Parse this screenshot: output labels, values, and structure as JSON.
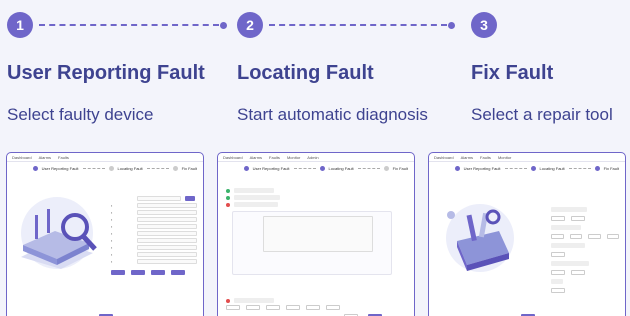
{
  "steps": [
    {
      "number": "1",
      "title": "User Reporting Fault",
      "subtitle": "Select faulty device"
    },
    {
      "number": "2",
      "title": "Locating Fault",
      "subtitle": "Start automatic diagnosis"
    },
    {
      "number": "3",
      "title": "Fix Fault",
      "subtitle": "Select a repair tool"
    }
  ],
  "panel_nav": [
    "Dashboard",
    "Alarms",
    "Faults",
    "Monitor",
    "Admin"
  ],
  "panel_steps": [
    "User Reporting Fault",
    "Locating Fault",
    "Fix Fault"
  ],
  "colors": {
    "accent": "#6f66c9",
    "title": "#3e4390",
    "background": "#f3f4fb"
  }
}
